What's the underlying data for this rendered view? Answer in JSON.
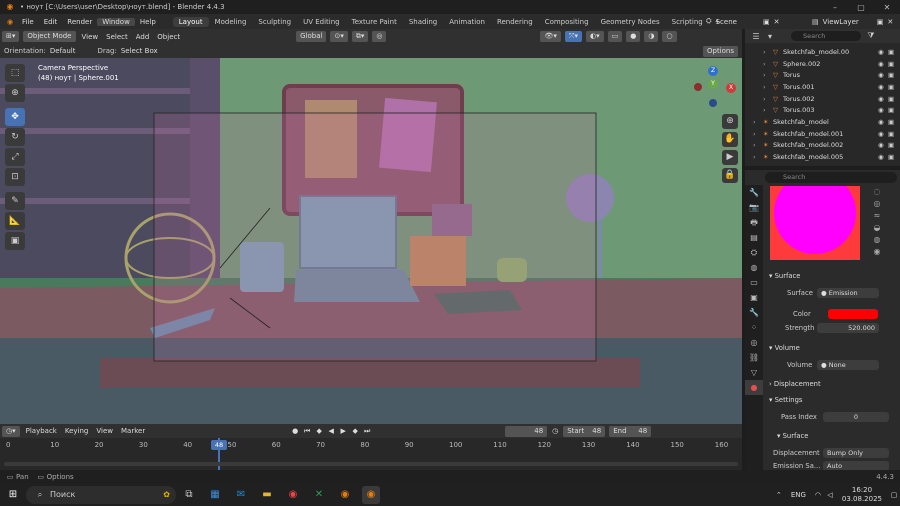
{
  "window": {
    "title": "• ноут [C:\\Users\\user\\Desktop\\ноут.blend] - Blender 4.4.3",
    "min": "–",
    "max": "▢",
    "close": "✕"
  },
  "menu": {
    "items": [
      "File",
      "Edit",
      "Render",
      "Window",
      "Help"
    ],
    "active": "Window"
  },
  "workspaces": [
    "Layout",
    "Modeling",
    "Sculpting",
    "UV Editing",
    "Texture Paint",
    "Shading",
    "Animation",
    "Rendering",
    "Compositing",
    "Geometry Nodes",
    "Scripting"
  ],
  "active_workspace": "Layout",
  "scene": {
    "label": "Scene",
    "viewlayer": "ViewLayer",
    "add": "+"
  },
  "viewport_header": {
    "mode": "Object Mode",
    "view": "View",
    "select": "Select",
    "add": "Add",
    "object": "Object",
    "transform": "Global"
  },
  "viewport_header2": {
    "orientation_label": "Orientation:",
    "orientation": "Default",
    "drag_label": "Drag:",
    "drag": "Select Box",
    "options": "Options"
  },
  "viewport": {
    "camera_label": "Camera Perspective",
    "object_label": "(48) ноут | Sphere.001",
    "axis_x": "X",
    "axis_y": "Y",
    "axis_z": "Z"
  },
  "outliner": {
    "search_placeholder": "Search",
    "rows": [
      {
        "name": "Sketchfab_model.00",
        "indent": 2
      },
      {
        "name": "Sphere.002",
        "indent": 2
      },
      {
        "name": "Torus",
        "indent": 2
      },
      {
        "name": "Torus.001",
        "indent": 2
      },
      {
        "name": "Torus.002",
        "indent": 2
      },
      {
        "name": "Torus.003",
        "indent": 2
      },
      {
        "name": "Sketchfab_model",
        "indent": 1
      },
      {
        "name": "Sketchfab_model.001",
        "indent": 1
      },
      {
        "name": "Sketchfab_model.002",
        "indent": 1
      },
      {
        "name": "Sketchfab_model.005",
        "indent": 1
      }
    ]
  },
  "properties": {
    "search_placeholder": "Search",
    "surface_header": "Surface",
    "surface_label": "Surface",
    "surface_value": "Emission",
    "color_label": "Color",
    "color_value": "#ff0000",
    "strength_label": "Strength",
    "strength_value": "520.000",
    "volume_header": "Volume",
    "volume_label": "Volume",
    "volume_value": "None",
    "displacement_header": "Displacement",
    "settings_header": "Settings",
    "pass_index_label": "Pass Index",
    "pass_index_value": "0",
    "surface_sub_header": "Surface",
    "displacement_label": "Displacement",
    "displacement_value": "Bump Only",
    "emission_label": "Emission Sa...",
    "emission_value": "Auto",
    "preview_color": "#ff00ff"
  },
  "timeline_header": {
    "playback": "Playback",
    "keying": "Keying",
    "view": "View",
    "marker": "Marker",
    "current_frame": "48",
    "start_label": "Start",
    "start": "48",
    "end_label": "End",
    "end": "48"
  },
  "timeline": {
    "ticks": [
      "0",
      "10",
      "20",
      "30",
      "40",
      "50",
      "60",
      "70",
      "80",
      "90",
      "100",
      "110",
      "120",
      "130",
      "140",
      "150",
      "160"
    ],
    "playhead": "48"
  },
  "statusbar": {
    "pan": "Pan",
    "options": "Options",
    "version": "4.4.3"
  },
  "taskbar": {
    "search": "Поиск",
    "lang": "ENG",
    "time": "16:20",
    "date": "03.08.2025"
  }
}
